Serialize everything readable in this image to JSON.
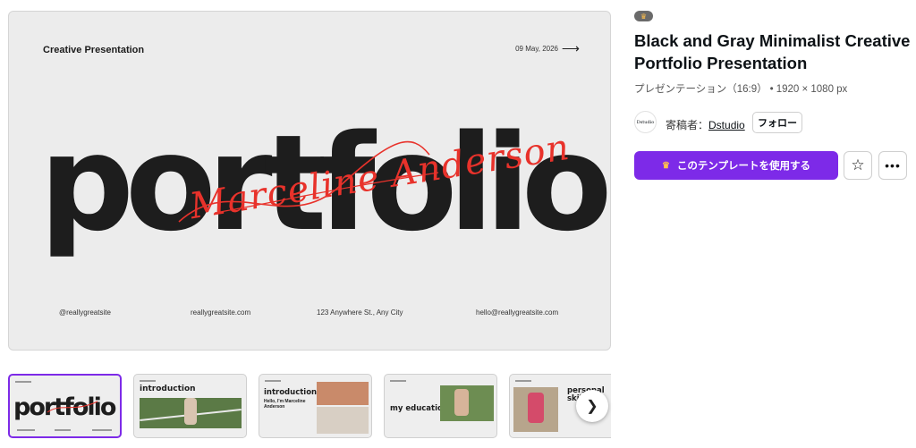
{
  "preview": {
    "header_title": "Creative Presentation",
    "date": "09 May, 2026",
    "big_word": "portfolio",
    "script_name": "Marceline Anderson",
    "footer": [
      "@reallygreatsite",
      "reallygreatsite.com",
      "123 Anywhere St., Any City",
      "hello@reallygreatsite.com"
    ]
  },
  "thumbnails": [
    {
      "big": "portfolio",
      "selected": true
    },
    {
      "big": "introduction",
      "selected": false
    },
    {
      "big": "introduction",
      "sub": "Hello, I'm Marceline Anderson",
      "selected": false
    },
    {
      "big": "my education",
      "selected": false
    },
    {
      "big": "personal skill",
      "selected": false
    }
  ],
  "info": {
    "title": "Black and Gray Minimalist Creative Portfolio Presentation",
    "type": "プレゼンテーション（16:9）",
    "dimensions": "1920 × 1080 px",
    "avatar_text": "Dstudio",
    "contributor_label": "寄稿者：",
    "contributor_name": "Dstudio",
    "follow_label": "フォロー",
    "use_template_label": "このテンプレートを使用する"
  },
  "colors": {
    "accent": "#7d2ae8",
    "script_red": "#e8322b",
    "crown": "#ffc04d"
  },
  "icons": [
    "crown-icon",
    "arrow-right-icon",
    "chevron-right-icon",
    "star-icon",
    "more-icon"
  ]
}
